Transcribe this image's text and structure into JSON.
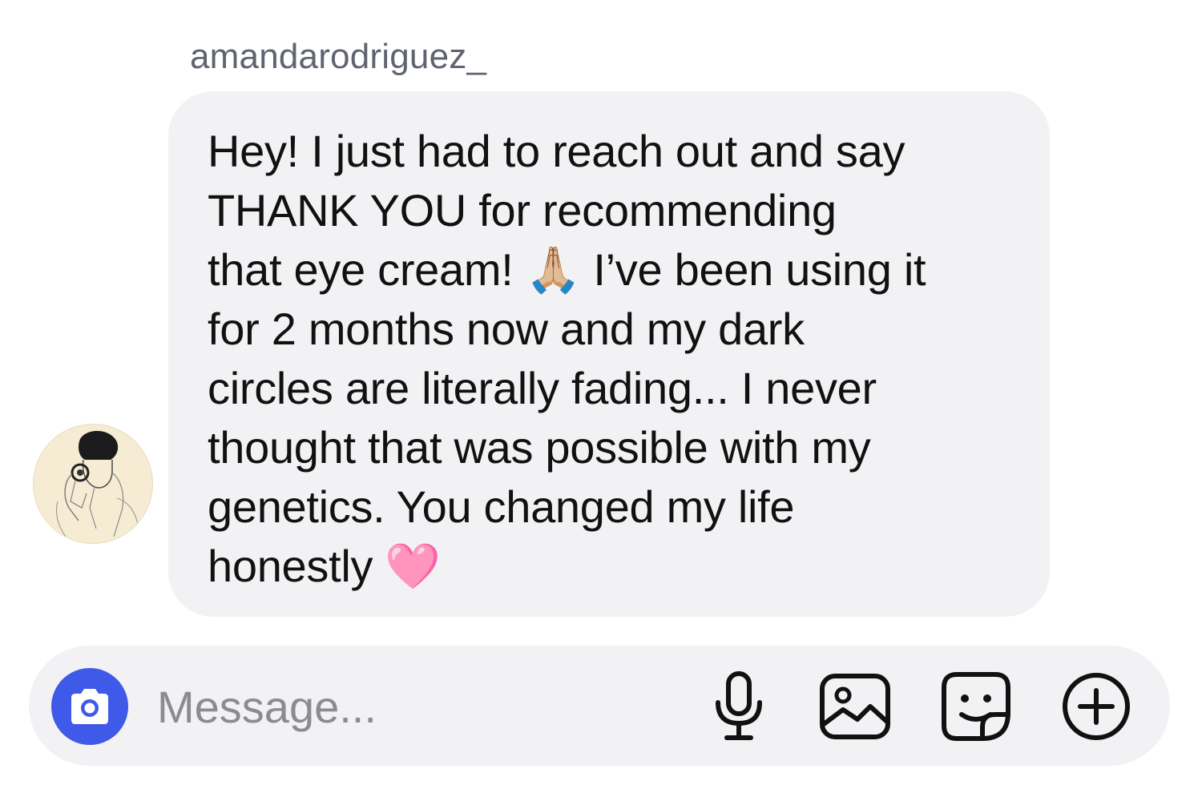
{
  "chat": {
    "sender_name": "amandarodriguez_",
    "message_text": "Hey! I just had to reach out and say\nTHANK YOU for recommending\nthat eye cream! 🙏🏼 I’ve been using it\nfor 2 months now and my dark\ncircles are literally fading... I never\nthought that was possible with my\ngenetics. You changed my life\nhonestly 🩷",
    "avatar_icon": "sketch-portrait-avatar"
  },
  "composer": {
    "placeholder": "Message...",
    "value": "",
    "camera_icon": "camera-icon",
    "mic_icon": "microphone-icon",
    "gallery_icon": "image-gallery-icon",
    "sticker_icon": "sticker-icon",
    "plus_icon": "plus-circle-icon"
  },
  "colors": {
    "bubble_bg": "#f2f2f4",
    "composer_bg": "#f2f2f4",
    "camera_accent": "#3f5ae8",
    "sender_name": "#5f6470",
    "placeholder": "#8a8c92"
  }
}
